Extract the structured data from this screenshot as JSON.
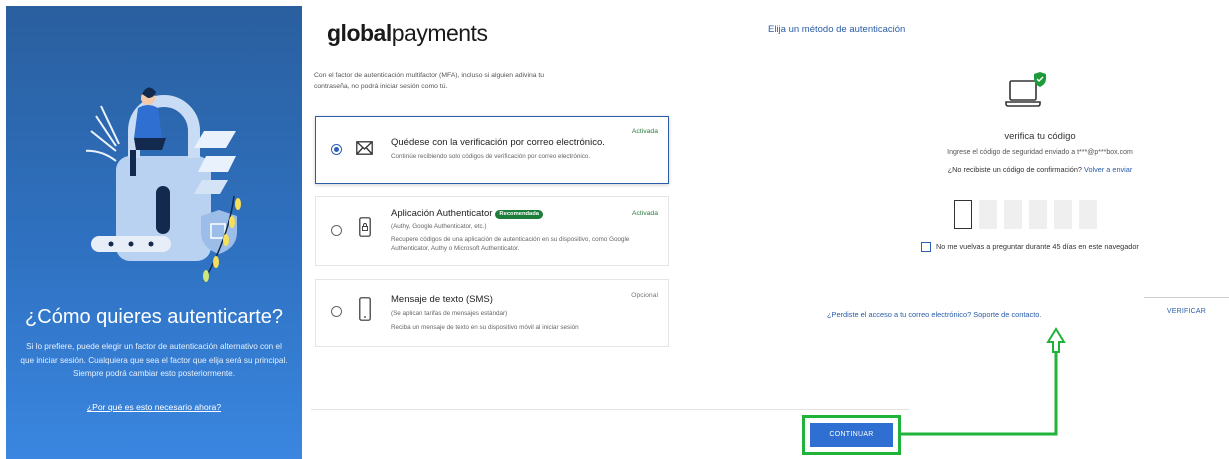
{
  "left": {
    "title": "¿Cómo quieres autenticarte?",
    "description": "Si lo prefiere, puede elegir un factor de autenticación alternativo con el que iniciar sesión. Cualquiera que sea el factor que elija será su principal. Siempre podrá cambiar esto posteriormente.",
    "why_link": "¿Por qué es esto necesario ahora?"
  },
  "header": {
    "logo_bold": "global",
    "logo_light": "payments",
    "method_link": "Elija un método de autenticación"
  },
  "intro": "Con el factor de autenticación multifactor (MFA), incluso si alguien adivina tu contraseña, no podrá iniciar sesión como tú.",
  "options": [
    {
      "title": "Quédese con la verificación por correo electrónico.",
      "subtitle": "Continúe recibiendo solo códigos de verificación por correo electrónico.",
      "status": "Activada",
      "selected": true
    },
    {
      "title": "Aplicación Authenticator",
      "badge": "Recomendada",
      "subtitle": "(Authy, Google Authenticator, etc.)",
      "description": "Recupere códigos de una aplicación de autenticación en su dispositivo, como Google Authenticator, Authy o Microsoft Authenticator.",
      "status": "Activada",
      "selected": false
    },
    {
      "title": "Mensaje de texto (SMS)",
      "subtitle": "(Se aplican tarifas de mensajes estándar)",
      "description": "Reciba un mensaje de texto en su dispositivo móvil al iniciar sesión",
      "status": "Opcional",
      "selected": false
    }
  ],
  "continue_label": "CONTINUAR",
  "verify": {
    "title": "verifica tu código",
    "info": "Ingrese el código de seguridad enviado a t***@p***box.com",
    "resend_question": "¿No recibiste un código de confirmación?",
    "resend_link": "Volver a enviar",
    "remember_label": "No me vuelvas a preguntar durante 45 días en este navegador",
    "support_link": "¿Perdiste el acceso a tu correo electrónico? Soporte de contacto.",
    "verify_button": "VERIFICAR"
  },
  "colors": {
    "primary": "#2f6fd1",
    "link": "#2a5da8",
    "success": "#1d7d3a",
    "highlight": "#1fb33a"
  }
}
